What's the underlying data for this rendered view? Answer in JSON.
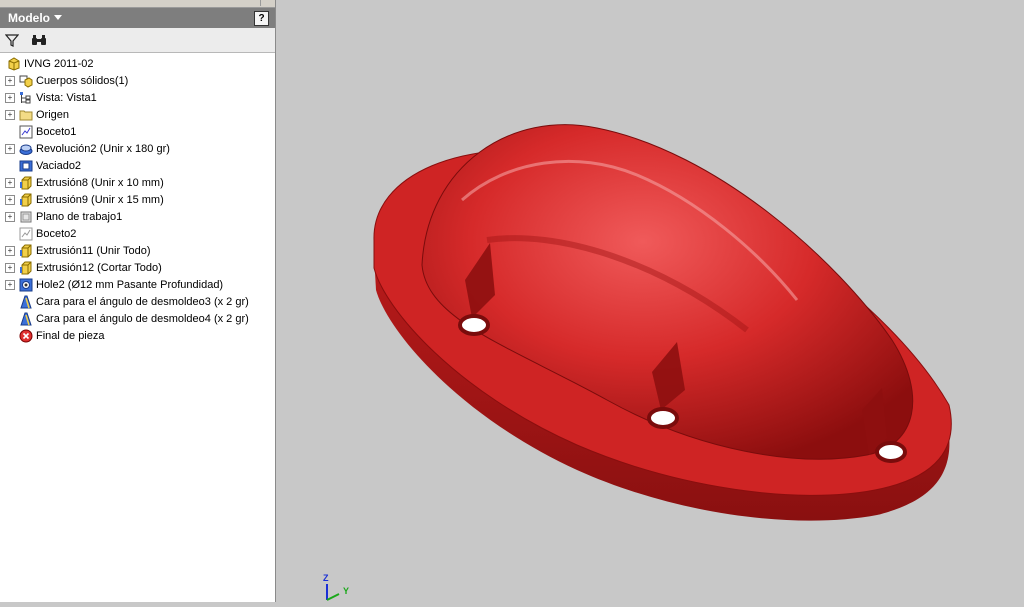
{
  "panel": {
    "title": "Modelo",
    "help_label": "?",
    "toolbar": {
      "filter_icon": "filter-icon",
      "find_icon": "binoculars-icon"
    }
  },
  "tree": {
    "root": "IVNG 2011-02",
    "items": [
      {
        "label": "Cuerpos sólidos(1)",
        "icon": "solid-bodies-icon",
        "expandable": true
      },
      {
        "label": "Vista: Vista1",
        "icon": "view-icon",
        "expandable": true
      },
      {
        "label": "Origen",
        "icon": "folder-icon",
        "expandable": true
      },
      {
        "label": "Boceto1",
        "icon": "sketch-icon",
        "expandable": false
      },
      {
        "label": "Revolución2 (Unir x 180 gr)",
        "icon": "revolve-icon",
        "expandable": true
      },
      {
        "label": "Vaciado2",
        "icon": "shell-icon",
        "expandable": false
      },
      {
        "label": "Extrusión8 (Unir x 10 mm)",
        "icon": "extrude-icon",
        "expandable": true
      },
      {
        "label": "Extrusión9 (Unir x 15 mm)",
        "icon": "extrude-icon",
        "expandable": true
      },
      {
        "label": "Plano de trabajo1",
        "icon": "work-plane-icon",
        "expandable": true
      },
      {
        "label": "Boceto2",
        "icon": "sketch-icon",
        "expandable": false
      },
      {
        "label": "Extrusión11 (Unir Todo)",
        "icon": "extrude-icon",
        "expandable": true
      },
      {
        "label": "Extrusión12 (Cortar Todo)",
        "icon": "extrude-icon",
        "expandable": true
      },
      {
        "label": "Hole2 (Ø12 mm Pasante Profundidad)",
        "icon": "hole-icon",
        "expandable": true
      },
      {
        "label": "Cara para el ángulo de desmoldeo3 (x 2 gr)",
        "icon": "draft-icon",
        "expandable": false
      },
      {
        "label": "Cara para el ángulo de desmoldeo4 (x 2 gr)",
        "icon": "draft-icon",
        "expandable": false
      },
      {
        "label": "Final de pieza",
        "icon": "end-of-part-icon",
        "expandable": false
      }
    ]
  },
  "viewport": {
    "model_color": "#d42626",
    "triad": {
      "z_label": "Z",
      "y_label": "Y"
    }
  },
  "colors": {
    "panel_header": "#7e7e7e",
    "viewport_bg": "#c8c8c8"
  }
}
